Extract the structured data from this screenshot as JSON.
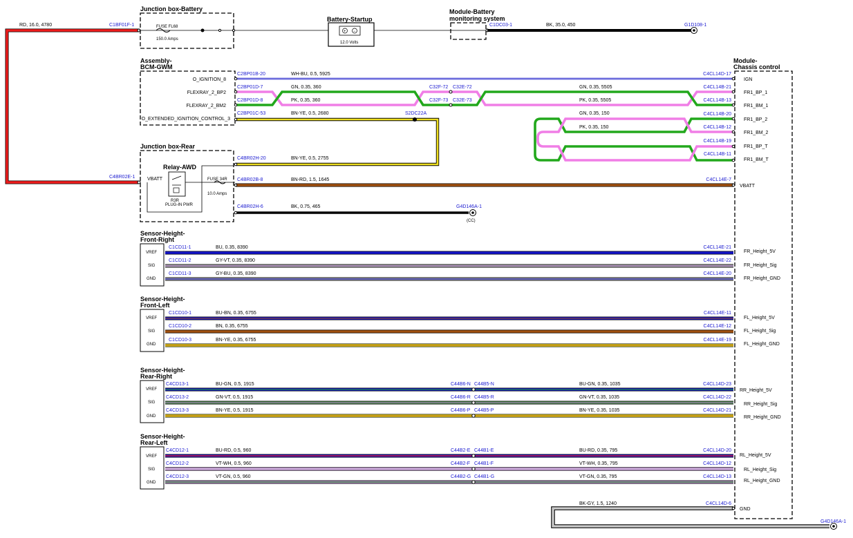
{
  "headers": {
    "jb_battery": "Junction box-Battery",
    "battery_startup": "Battery-Startup",
    "module_battery_1": "Module-Battery",
    "module_battery_2": "monitoring system",
    "assembly_1": "Assembly-",
    "assembly_2": "BCM-GWM",
    "module_chassis_1": "Module-",
    "module_chassis_2": "Chassis control",
    "jb_rear": "Junction box-Rear",
    "relay_awd": "Relay-AWD",
    "shfr_1": "Sensor-Height-",
    "shfr_2": "Front-Right",
    "shfl_1": "Sensor-Height-",
    "shfl_2": "Front-Left",
    "shrr_1": "Sensor-Height-",
    "shrr_2": "Rear-Right",
    "shrl_1": "Sensor-Height-",
    "shrl_2": "Rear-Left"
  },
  "top": {
    "wire_rd": "RD,  16.0,  4780",
    "conn_c1bf01f": "C1BF01F-1",
    "fuse_f68": "FUSE FL68",
    "fuse_f68_amps": "150.0 Amps",
    "battery_volts": "12.0 Volts",
    "conn_c1dc03": "C1DC03-1",
    "wire_bk35": "BK,  35.0,  450",
    "conn_g1d108": "G1D108-1"
  },
  "bcm": {
    "pins": [
      "O_IGNITION_8",
      "FLEXRAY_2_BP2",
      "FLEXRAY_2_BM2",
      "O_EXTENDED_IGNITION_CONTROL_3"
    ],
    "conns": [
      "C2BP01B-20",
      "C2BP01D-7",
      "C2BP01D-8",
      "C2BP01C-53"
    ],
    "wires": [
      "WH-BU,  0.5,  5925",
      "GN,  0.35,  360",
      "PK,  0.35,  360",
      "BN-YE,  0.5,  2680"
    ],
    "inline_1": "C32F-72",
    "inline_2": "C32E-72",
    "inline_3": "C32F-73",
    "inline_4": "C32E-73",
    "splice": "S2DC22A",
    "wire_gn_5505": "GN,  0.35,  5505",
    "wire_pk_5505": "PK,  0.35,  5505",
    "wire_gn_150": "GN,  0.35,  150",
    "wire_pk_150": "PK,  0.35,  150"
  },
  "chassis": {
    "conns": [
      "C4CL14D-17",
      "C4CL14B-21",
      "C4CL14B-13",
      "C4CL14B-20",
      "C4CL14B-12",
      "C4CL14B-19",
      "C4CL14B-11",
      "C4CL14E-7",
      "C4CL14E-21",
      "C4CL14E-22",
      "C4CL14E-20",
      "C4CL14E-11",
      "C4CL14E-12",
      "C4CL14E-19",
      "C4CL14D-23",
      "C4CL14D-22",
      "C4CL14D-21",
      "C4CL14D-20",
      "C4CL14D-12",
      "C4CL14D-13",
      "C4CL14D-6"
    ],
    "pins": [
      "IGN",
      "FR1_BP_1",
      "FR1_BM_1",
      "FR1_BP_2",
      "FR1_BM_2",
      "FR1_BP_T",
      "FR1_BM_T",
      "VBATT",
      "FR_Height_5V",
      "FR_Height_Sig",
      "FR_Height_GND",
      "FL_Height_5V",
      "FL_Height_Sig",
      "FL_Height_GND",
      "RR_Height_5V",
      "RR_Height_Sig",
      "RR_Height_GND",
      "RL_Height_5V",
      "RL_Height_Sig",
      "RL_Height_GND",
      "GND"
    ]
  },
  "rear": {
    "conn_c4br02e": "C4BR02E-1",
    "vbatt": "VBATT",
    "conn_h20": "C4BR02H-20",
    "wire_bnye_2755": "BN-YE,  0.5,  2755",
    "fuse_34r": "FUSE 34R",
    "fuse_34r_amps": "10.0 Amps",
    "relay_sub_1": "R3R",
    "relay_sub_2": "PLUG-IN PWR",
    "conn_b8": "C4BR02B-8",
    "wire_bnrd": "BN-RD,  1.5,  1645",
    "conn_h6": "C4BR02H-6",
    "wire_bk075": "BK,  0.75,  465",
    "conn_g4d146a": "G4D146A-1",
    "cc": "(CC)"
  },
  "sensor_pins": [
    "VREF",
    "SIG",
    "GND"
  ],
  "frontright": {
    "conns": [
      "C1CD11-1",
      "C1CD11-2",
      "C1CD11-3"
    ],
    "wires": [
      "BU,  0.35,  8390",
      "GY-VT,  0.35,  8390",
      "GY-BU,  0.35,  8390"
    ]
  },
  "frontleft": {
    "conns": [
      "C1CD10-1",
      "C1CD10-2",
      "C1CD10-3"
    ],
    "wires": [
      "BU-BN,  0.35,  6755",
      "BN,  0.35,  6755",
      "BN-YE,  0.35,  6755"
    ]
  },
  "rearright": {
    "conns": [
      "C4CD13-1",
      "C4CD13-2",
      "C4CD13-3"
    ],
    "wires": [
      "BU-GN,  0.5,  1915",
      "GN-VT,  0.5,  1915",
      "BN-YE,  0.5,  1915"
    ],
    "inline_a": [
      "C44B6-N",
      "C44B6-R",
      "C44B6-P"
    ],
    "inline_b": [
      "C44B5-N",
      "C44B5-R",
      "C44B5-P"
    ],
    "wires2": [
      "BU-GN,  0.35,  1035",
      "GN-VT,  0.35,  1035",
      "BN-YE,  0.35,  1035"
    ]
  },
  "rearleft": {
    "conns": [
      "C4CD12-1",
      "C4CD12-2",
      "C4CD12-3"
    ],
    "wires": [
      "BU-RD,  0.5,  960",
      "VT-WH,  0.5,  960",
      "VT-GN,  0.5,  960"
    ],
    "inline_a": [
      "C44B2-E",
      "C44B2-F",
      "C44B2-G"
    ],
    "inline_b": [
      "C44B1-E",
      "C44B1-F",
      "C44B1-G"
    ],
    "wires2": [
      "BU-RD,  0.35,  795",
      "VT-WH,  0.35,  795",
      "VT-GN,  0.35,  795"
    ]
  },
  "ground": {
    "wire": "BK-GY,  1.5,  1240",
    "conn": "G4D146A-1"
  },
  "colors": {
    "red": "#ee1c1c",
    "green": "#22a81c",
    "pink": "#f07ee6",
    "blue": "#1414c8",
    "brown": "#a05010",
    "yellow": "#f0e020",
    "gray": "#9a9a9a",
    "connector_text": "#1a1ad0"
  }
}
